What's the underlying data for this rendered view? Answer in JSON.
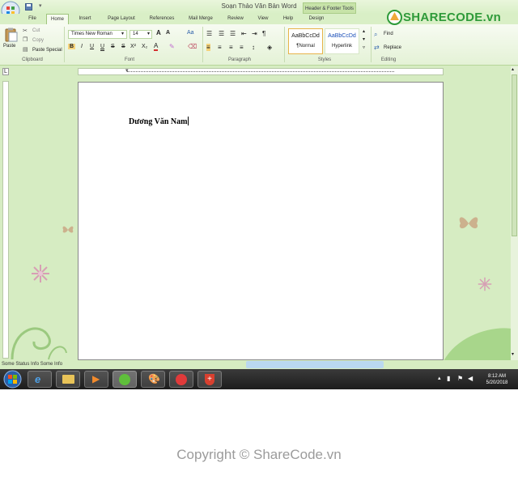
{
  "window": {
    "title": "Soạn Thảo Văn Bản Word",
    "contextual_tab_group": "Header & Footer Tools"
  },
  "tabs": [
    "File",
    "Home",
    "Insert",
    "Page Layout",
    "References",
    "Mail Merge",
    "Review",
    "View",
    "Help",
    "Design"
  ],
  "active_tab": "Home",
  "clipboard": {
    "paste": "Paste",
    "cut": "Cut",
    "copy": "Copy",
    "paste_special": "Paste Special",
    "group_label": "Clipboard"
  },
  "font": {
    "name": "Times New Roman",
    "size": "14",
    "group_label": "Font"
  },
  "paragraph": {
    "group_label": "Paragraph"
  },
  "styles": {
    "normal_preview": "AaBbCcDd",
    "normal_label": "¶Normal",
    "hyperlink_preview": "AaBbCcDd",
    "hyperlink_label": "Hyperlink",
    "group_label": "Styles"
  },
  "editing": {
    "find": "Find",
    "replace": "Replace",
    "group_label": "Editing"
  },
  "document": {
    "text": "Dương Văn Nam"
  },
  "status": {
    "text": "Some Status Info  Some Info"
  },
  "clock": {
    "time": "8:12 AM",
    "date": "5/20/2018"
  },
  "logo": {
    "text": "SHARECODE.vn"
  },
  "watermark": {
    "text": "Copyright © ShareCode.vn"
  },
  "colors": {
    "accent_green": "#2e9a39",
    "ribbon_bg": "#e4f2d6",
    "taskbar": "#1d1d1d"
  }
}
